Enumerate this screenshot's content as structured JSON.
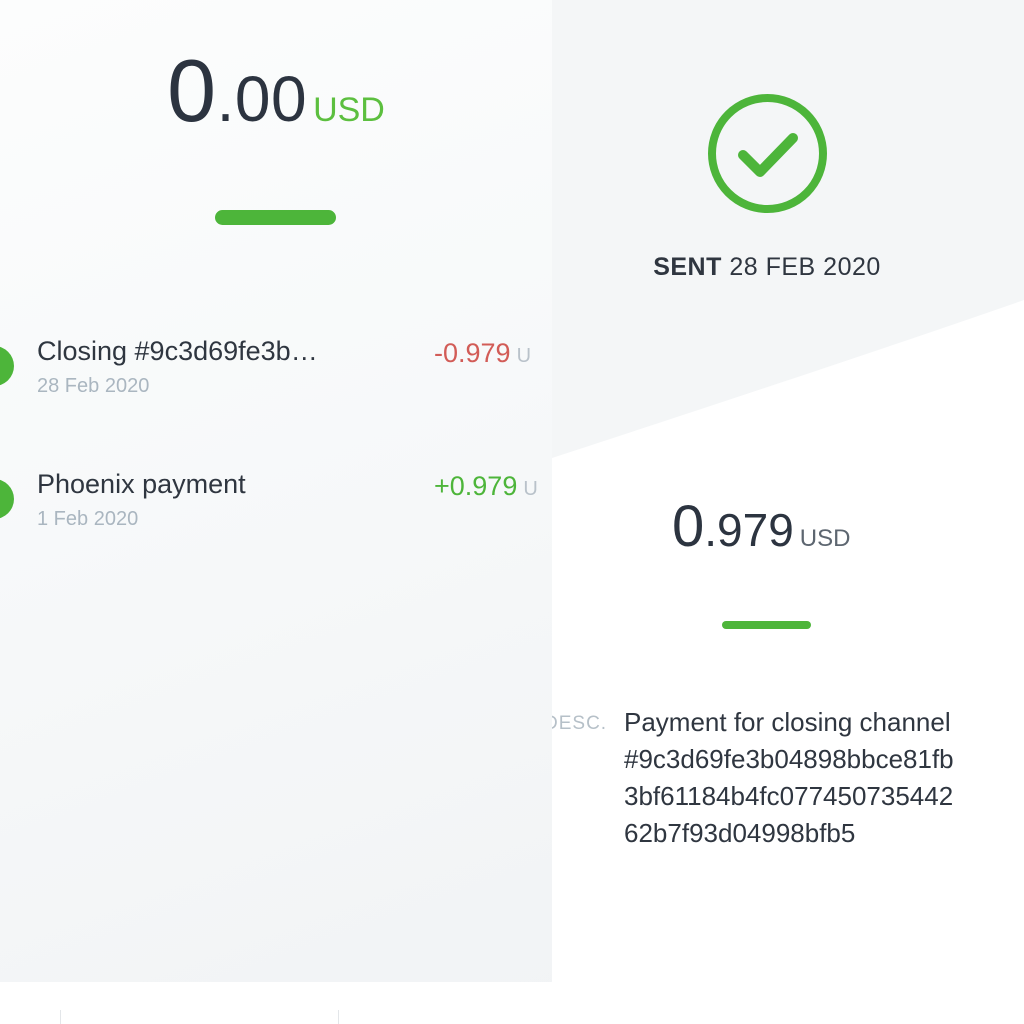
{
  "wallet": {
    "balance_integer": "0",
    "balance_decimal": ".00",
    "balance_unit": "USD",
    "transactions": [
      {
        "title": "Closing #9c3d69fe3b…",
        "date": "28 Feb 2020",
        "amount": "-0.979",
        "unit": "U"
      },
      {
        "title": "Phoenix payment",
        "date": "1 Feb 2020",
        "amount": "+0.979",
        "unit": "U"
      }
    ]
  },
  "detail": {
    "status_label": "SENT",
    "status_date": "28 FEB 2020",
    "amount_integer": "0",
    "amount_decimal": ".979",
    "amount_unit": "USD",
    "desc_label": "DESC.",
    "description_lines": [
      "Payment for closing channel",
      "#9c3d69fe3b04898bbce81fb",
      "3bf61184b4fc077450735442",
      "62b7f93d04998bfb5"
    ]
  },
  "colors": {
    "accent_green": "#4db53a",
    "negative_red": "#d25c57",
    "muted_text": "#aab6c0"
  },
  "icons": {
    "status": "check-circle-icon"
  }
}
